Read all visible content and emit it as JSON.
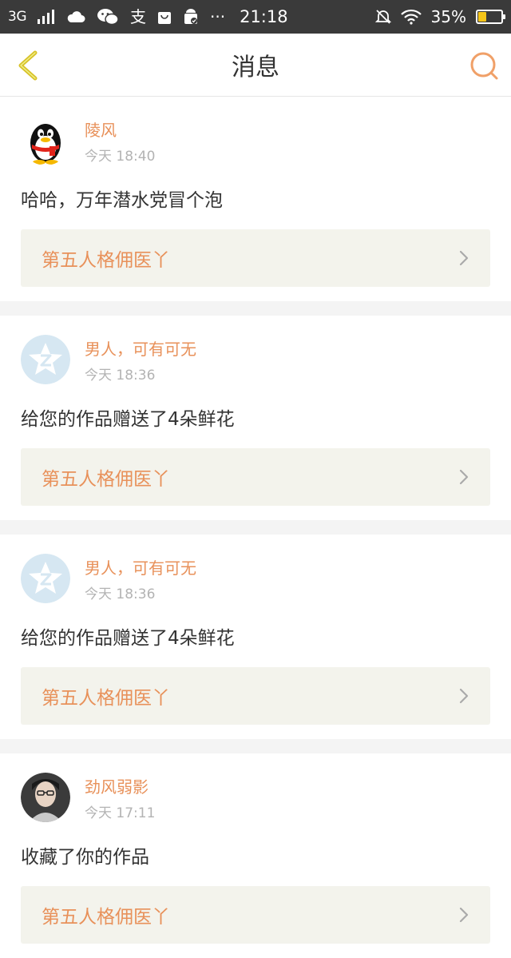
{
  "status_bar": {
    "network": "3G",
    "time": "21:18",
    "battery": "35%",
    "battery_level": 0.35
  },
  "header": {
    "title": "消息",
    "back_icon": "chevron-left-icon",
    "search_icon": "search-icon"
  },
  "messages": [
    {
      "username": "陵风",
      "time": "今天 18:40",
      "text": "哈哈，万年潜水党冒个泡",
      "work": "第五人格佣医丫",
      "avatar": "penguin"
    },
    {
      "username": "男人，可有可无",
      "time": "今天 18:36",
      "text": "给您的作品赠送了4朵鲜花",
      "work": "第五人格佣医丫",
      "avatar": "default-star"
    },
    {
      "username": "男人，可有可无",
      "time": "今天 18:36",
      "text": "给您的作品赠送了4朵鲜花",
      "work": "第五人格佣医丫",
      "avatar": "default-star"
    },
    {
      "username": "劲风弱影",
      "time": "今天 17:11",
      "text": "收藏了你的作品",
      "work": "第五人格佣医丫",
      "avatar": "photo"
    }
  ],
  "colors": {
    "accent": "#e8915a",
    "header_icon": "#d8c229",
    "search_icon": "#f0a068"
  }
}
